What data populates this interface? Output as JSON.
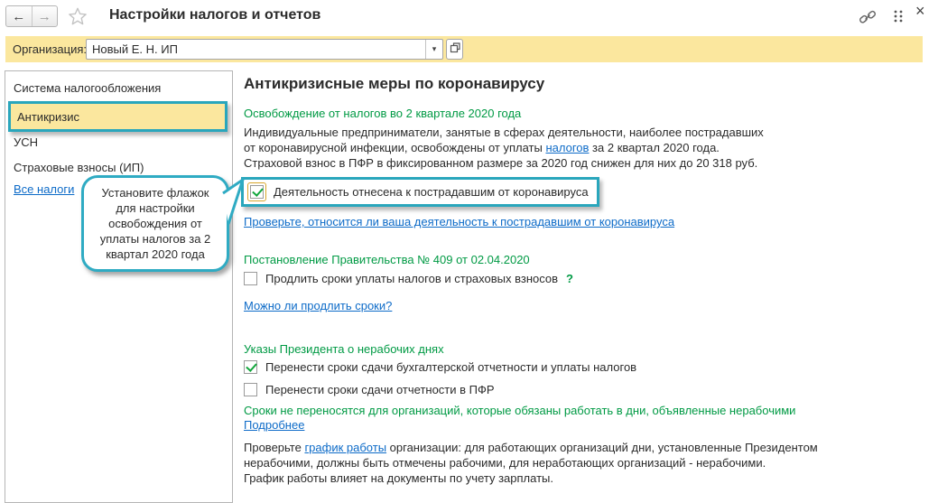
{
  "colors": {
    "accent_teal": "#29a6bc",
    "highlight_yellow": "#fbe79e",
    "heading_green": "#009a44",
    "link_blue": "#0d6bc8"
  },
  "icons": {
    "back": "←",
    "forward": "→",
    "close": "×",
    "dropdown": "▾"
  },
  "header": {
    "title": "Настройки налогов и отчетов"
  },
  "org_bar": {
    "label": "Организация:",
    "value": "Новый Е. Н. ИП"
  },
  "sidebar": {
    "items": [
      {
        "label": "Система налогообложения",
        "selected": false
      },
      {
        "label": "Антикризис",
        "selected": true
      },
      {
        "label": "УСН",
        "selected": false
      },
      {
        "label": "Страховые взносы (ИП)",
        "selected": false
      }
    ],
    "all_taxes_link": "Все налоги"
  },
  "tooltip": {
    "text": "Установите флажок для настройки освобождения от уплаты налогов за 2 квартал 2020 года"
  },
  "main": {
    "title": "Антикризисные меры по коронавирусу",
    "exemption": {
      "heading": "Освобождение от налогов во 2 квартале 2020 года",
      "line1": "Индивидуальные предприниматели, занятые в сферах деятельности, наиболее пострадавших",
      "line2_pre": "от коронавирусной инфекции, освобождены от уплаты ",
      "line2_link": "налогов",
      "line2_post": " за 2 квартал 2020 года.",
      "line3": "Страховой взнос в ПФР в фиксированном размере за 2020 год снижен для них до 20 318 руб.",
      "checkbox": {
        "label": "Деятельность отнесена к пострадавшим от коронавируса",
        "checked": "true"
      },
      "check_link": "Проверьте, относится ли ваша деятельность к пострадавшим от коронавируса"
    },
    "decree": {
      "heading": "Постановление Правительства № 409 от 02.04.2020",
      "checkbox": {
        "label": "Продлить сроки уплаты налогов и страховых взносов",
        "checked": "false"
      },
      "hint_mark": "?",
      "link": "Можно ли продлить сроки?"
    },
    "president": {
      "heading": "Указы Президента о нерабочих днях",
      "checkbox1": {
        "label": "Перенести сроки сдачи бухгалтерской отчетности и уплаты налогов",
        "checked": "true"
      },
      "checkbox2": {
        "label": "Перенести сроки сдачи отчетности в ПФР",
        "checked": "false"
      },
      "note": "Сроки не переносятся для организаций, которые обязаны работать в дни, объявленные нерабочими",
      "more_link": "Подробнее",
      "schedule_pre": "Проверьте ",
      "schedule_link": "график работы",
      "schedule_post": " организации: для работающих организаций дни, установленные Президентом",
      "schedule_line2": "нерабочими, должны быть отмечены рабочими, для неработающих организаций - нерабочими.",
      "schedule_line3": "График работы влияет на документы по учету зарплаты."
    }
  }
}
